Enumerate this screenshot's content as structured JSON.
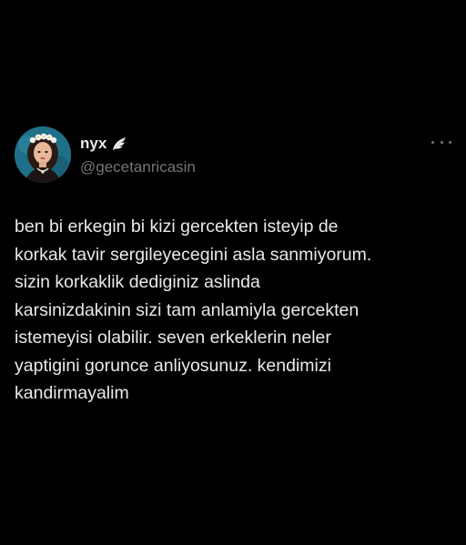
{
  "author": {
    "display_name": "nyx",
    "handle": "@gecetanricasin",
    "verified_emoji": "wing-icon"
  },
  "menu": {
    "more_icon": "more-horizontal-icon"
  },
  "tweet": {
    "lines": [
      "ben bi erkegin bi kizi gercekten isteyip de",
      "korkak tavir sergileyecegini asla sanmiyorum.",
      "sizin korkaklik dediginiz aslinda",
      "karsinizdakinin sizi tam anlamiyla gercekten",
      "istemeyisi olabilir. seven erkeklerin neler",
      "yaptigini gorunce anliyosunuz. kendimizi",
      "kandirmayalim"
    ]
  },
  "colors": {
    "background": "#000000",
    "text_primary": "#e7e9ea",
    "text_secondary": "#71767b"
  }
}
